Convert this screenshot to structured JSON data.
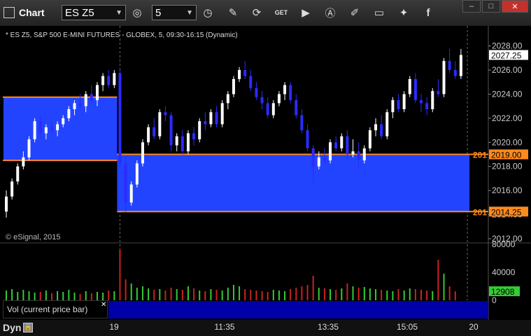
{
  "window": {
    "title": "Chart"
  },
  "toolbar": {
    "symbol": "ES Z5",
    "interval": "5",
    "icons": [
      "target-icon",
      "history-icon",
      "pencil-icon",
      "refresh-icon",
      "get-icon",
      "play-icon",
      "alert-icon",
      "tools-icon",
      "chat-icon",
      "twitter-icon",
      "facebook-icon"
    ],
    "window_buttons": [
      "minimize",
      "maximize",
      "close"
    ]
  },
  "chart": {
    "header": "* ES Z5, S&P 500 E-MINI FUTURES - GLOBEX, 5, 09:30-16:15 (Dynamic)",
    "copyright": "© eSignal, 2015",
    "price_axis": [
      "2028.00",
      "2026.00",
      "2024.00",
      "2022.00",
      "2020.00",
      "2018.00",
      "2016.00",
      "2014.00",
      "2012.00"
    ],
    "last_price_label": "2027.25",
    "level_labels": [
      "2019.00",
      "2014.25"
    ],
    "level_prefix": "201",
    "volume_axis": [
      "80000",
      "40000",
      "0"
    ],
    "last_volume_label": "12908",
    "time_labels": [
      "19",
      "11:35",
      "13:35",
      "15:05",
      "20"
    ],
    "volume_study_label": "Vol (current price bar)",
    "mode": "Dyn"
  },
  "colors": {
    "up": "#ffffff",
    "down": "#2b2bff",
    "zone": "#2244ff",
    "level": "#ff8a1a",
    "vol_up": "#33cc33",
    "vol_down": "#cc2222"
  },
  "chart_data": {
    "type": "candlestick",
    "symbol": "ES Z5",
    "ylim": [
      2012,
      2028.5
    ],
    "bars": [
      [
        2014.25,
        2016.0,
        2013.75,
        2015.5
      ],
      [
        2015.5,
        2017.0,
        2015.25,
        2016.75
      ],
      [
        2016.75,
        2018.25,
        2016.5,
        2018.0
      ],
      [
        2018.0,
        2019.25,
        2017.75,
        2018.75
      ],
      [
        2018.75,
        2020.5,
        2018.5,
        2020.25
      ],
      [
        2020.25,
        2022.0,
        2020.0,
        2021.75
      ],
      [
        2021.75,
        2022.25,
        2020.25,
        2020.75
      ],
      [
        2020.75,
        2021.5,
        2020.25,
        2021.25
      ],
      [
        2021.25,
        2021.75,
        2020.75,
        2021.0
      ],
      [
        2021.0,
        2021.75,
        2020.5,
        2021.5
      ],
      [
        2021.5,
        2022.25,
        2021.25,
        2022.0
      ],
      [
        2022.0,
        2023.0,
        2021.75,
        2022.75
      ],
      [
        2022.75,
        2023.5,
        2022.25,
        2023.25
      ],
      [
        2023.25,
        2024.0,
        2022.75,
        2023.0
      ],
      [
        2023.0,
        2024.25,
        2022.5,
        2024.0
      ],
      [
        2024.0,
        2024.75,
        2023.25,
        2023.5
      ],
      [
        2023.5,
        2025.0,
        2023.0,
        2024.75
      ],
      [
        2024.75,
        2025.75,
        2024.25,
        2025.5
      ],
      [
        2025.5,
        2026.0,
        2024.5,
        2024.75
      ],
      [
        2024.75,
        2026.0,
        2024.5,
        2025.75
      ],
      [
        2025.75,
        2026.0,
        2017.75,
        2018.25
      ],
      [
        2018.25,
        2018.75,
        2014.25,
        2015.0
      ],
      [
        2015.0,
        2016.75,
        2014.75,
        2016.5
      ],
      [
        2016.5,
        2018.5,
        2016.25,
        2018.25
      ],
      [
        2018.25,
        2020.25,
        2018.0,
        2020.0
      ],
      [
        2020.0,
        2021.5,
        2019.75,
        2021.25
      ],
      [
        2021.25,
        2022.0,
        2020.25,
        2020.5
      ],
      [
        2020.5,
        2022.75,
        2020.25,
        2022.5
      ],
      [
        2022.5,
        2023.0,
        2021.75,
        2022.25
      ],
      [
        2022.25,
        2022.5,
        2019.25,
        2019.75
      ],
      [
        2019.75,
        2020.75,
        2019.25,
        2020.5
      ],
      [
        2020.5,
        2021.0,
        2019.0,
        2019.25
      ],
      [
        2019.25,
        2021.0,
        2019.0,
        2020.75
      ],
      [
        2020.75,
        2021.25,
        2019.75,
        2020.25
      ],
      [
        2020.25,
        2022.0,
        2020.0,
        2021.75
      ],
      [
        2021.75,
        2022.5,
        2021.0,
        2021.5
      ],
      [
        2021.5,
        2022.75,
        2021.25,
        2022.5
      ],
      [
        2022.5,
        2023.0,
        2021.25,
        2021.5
      ],
      [
        2021.5,
        2023.5,
        2021.25,
        2023.25
      ],
      [
        2023.25,
        2024.25,
        2022.75,
        2024.0
      ],
      [
        2024.0,
        2025.5,
        2023.75,
        2025.25
      ],
      [
        2025.25,
        2026.25,
        2025.0,
        2026.0
      ],
      [
        2026.0,
        2026.75,
        2025.25,
        2025.5
      ],
      [
        2025.5,
        2026.0,
        2024.25,
        2024.5
      ],
      [
        2024.5,
        2025.0,
        2023.5,
        2023.75
      ],
      [
        2023.75,
        2024.25,
        2022.75,
        2023.25
      ],
      [
        2023.25,
        2023.75,
        2022.0,
        2022.25
      ],
      [
        2022.25,
        2023.5,
        2022.0,
        2023.25
      ],
      [
        2023.25,
        2024.25,
        2023.0,
        2024.0
      ],
      [
        2024.0,
        2025.0,
        2023.5,
        2024.75
      ],
      [
        2024.75,
        2025.0,
        2023.25,
        2023.5
      ],
      [
        2023.5,
        2024.0,
        2022.0,
        2022.25
      ],
      [
        2022.25,
        2022.75,
        2020.75,
        2021.0
      ],
      [
        2021.0,
        2021.5,
        2019.25,
        2019.5
      ],
      [
        2019.5,
        2019.75,
        2016.5,
        2018.0
      ],
      [
        2018.0,
        2019.25,
        2017.75,
        2018.75
      ],
      [
        2018.75,
        2019.5,
        2018.25,
        2018.5
      ],
      [
        2018.5,
        2020.25,
        2018.25,
        2020.0
      ],
      [
        2020.0,
        2020.5,
        2019.25,
        2019.5
      ],
      [
        2019.5,
        2020.75,
        2019.25,
        2020.5
      ],
      [
        2020.5,
        2021.0,
        2018.5,
        2019.0
      ],
      [
        2019.0,
        2020.25,
        2018.75,
        2019.25
      ],
      [
        2019.25,
        2020.0,
        2017.75,
        2018.5
      ],
      [
        2018.5,
        2019.75,
        2018.25,
        2019.5
      ],
      [
        2019.5,
        2021.25,
        2019.25,
        2021.0
      ],
      [
        2021.0,
        2022.0,
        2020.5,
        2021.5
      ],
      [
        2021.5,
        2022.25,
        2020.25,
        2020.5
      ],
      [
        2020.5,
        2022.75,
        2020.25,
        2022.5
      ],
      [
        2022.5,
        2023.75,
        2022.0,
        2023.5
      ],
      [
        2023.5,
        2024.0,
        2022.5,
        2022.75
      ],
      [
        2022.75,
        2024.25,
        2022.5,
        2024.0
      ],
      [
        2024.0,
        2025.5,
        2023.75,
        2025.25
      ],
      [
        2025.25,
        2025.75,
        2023.25,
        2023.5
      ],
      [
        2023.5,
        2024.0,
        2022.5,
        2023.25
      ],
      [
        2023.25,
        2023.75,
        2022.25,
        2022.75
      ],
      [
        2022.75,
        2024.5,
        2022.5,
        2024.25
      ],
      [
        2024.25,
        2025.25,
        2023.75,
        2024.0
      ],
      [
        2024.0,
        2027.0,
        2023.75,
        2026.75
      ],
      [
        2026.75,
        2027.75,
        2025.75,
        2026.0
      ],
      [
        2026.0,
        2026.75,
        2025.25,
        2025.5
      ],
      [
        2025.5,
        2027.75,
        2025.25,
        2027.25
      ]
    ],
    "volume": [
      14000,
      16000,
      12000,
      15000,
      13000,
      11000,
      12000,
      14000,
      10000,
      13000,
      12000,
      15000,
      11000,
      9000,
      13000,
      10000,
      12000,
      11000,
      14000,
      13000,
      72000,
      30000,
      24000,
      18000,
      20000,
      17000,
      15000,
      16000,
      14000,
      18000,
      16000,
      15000,
      20000,
      17000,
      14000,
      13000,
      16000,
      15000,
      14000,
      18000,
      22000,
      20000,
      16000,
      15000,
      14000,
      13000,
      12000,
      15000,
      14000,
      13000,
      16000,
      18000,
      20000,
      22000,
      35000,
      18000,
      17000,
      16000,
      15000,
      17000,
      24000,
      20000,
      18000,
      19000,
      17000,
      16000,
      15000,
      14000,
      13000,
      16000,
      14000,
      17000,
      16000,
      15000,
      14000,
      13000,
      58000,
      38000,
      20000,
      12908
    ],
    "levels": [
      2019.0,
      2014.25
    ],
    "zones": [
      {
        "from_bar": 0,
        "to_bar": 20,
        "high": 2023.75,
        "low": 2018.5
      },
      {
        "from_bar": 20,
        "to_bar": 82,
        "high": 2019.0,
        "low": 2014.25
      }
    ],
    "volume_ylim": [
      0,
      80000
    ]
  }
}
